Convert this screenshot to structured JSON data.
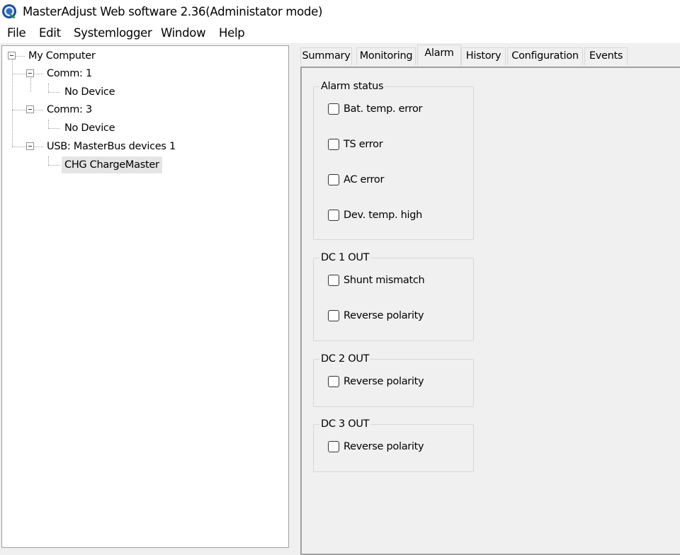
{
  "window": {
    "title": "MasterAdjust Web software 2.36(Administator mode)",
    "app_icon": "masteradjust-icon"
  },
  "menu": {
    "items": [
      "File",
      "Edit",
      "Systemlogger",
      "Window",
      "Help"
    ]
  },
  "tree": {
    "root": "My Computer",
    "comm1": "Comm: 1",
    "comm1_child": "No Device",
    "comm3": "Comm: 3",
    "comm3_child": "No Device",
    "usb": "USB: MasterBus devices 1",
    "usb_child": "CHG ChargeMaster",
    "selected": "CHG ChargeMaster"
  },
  "tabs": {
    "items": [
      "Summary",
      "Monitoring",
      "Alarm",
      "History",
      "Configuration",
      "Events"
    ],
    "active": "Alarm"
  },
  "alarm_status": {
    "title": "Alarm status",
    "items": [
      {
        "label": "Bat. temp. error",
        "checked": false
      },
      {
        "label": "TS error",
        "checked": false
      },
      {
        "label": "AC error",
        "checked": false
      },
      {
        "label": "Dev. temp. high",
        "checked": false
      }
    ]
  },
  "dc1_out": {
    "title": "DC 1 OUT",
    "items": [
      {
        "label": "Shunt mismatch",
        "checked": false
      },
      {
        "label": "Reverse polarity",
        "checked": false
      }
    ]
  },
  "dc2_out": {
    "title": "DC 2 OUT",
    "items": [
      {
        "label": "Reverse polarity",
        "checked": false
      }
    ]
  },
  "dc3_out": {
    "title": "DC 3 OUT",
    "items": [
      {
        "label": "Reverse polarity",
        "checked": false
      }
    ]
  }
}
